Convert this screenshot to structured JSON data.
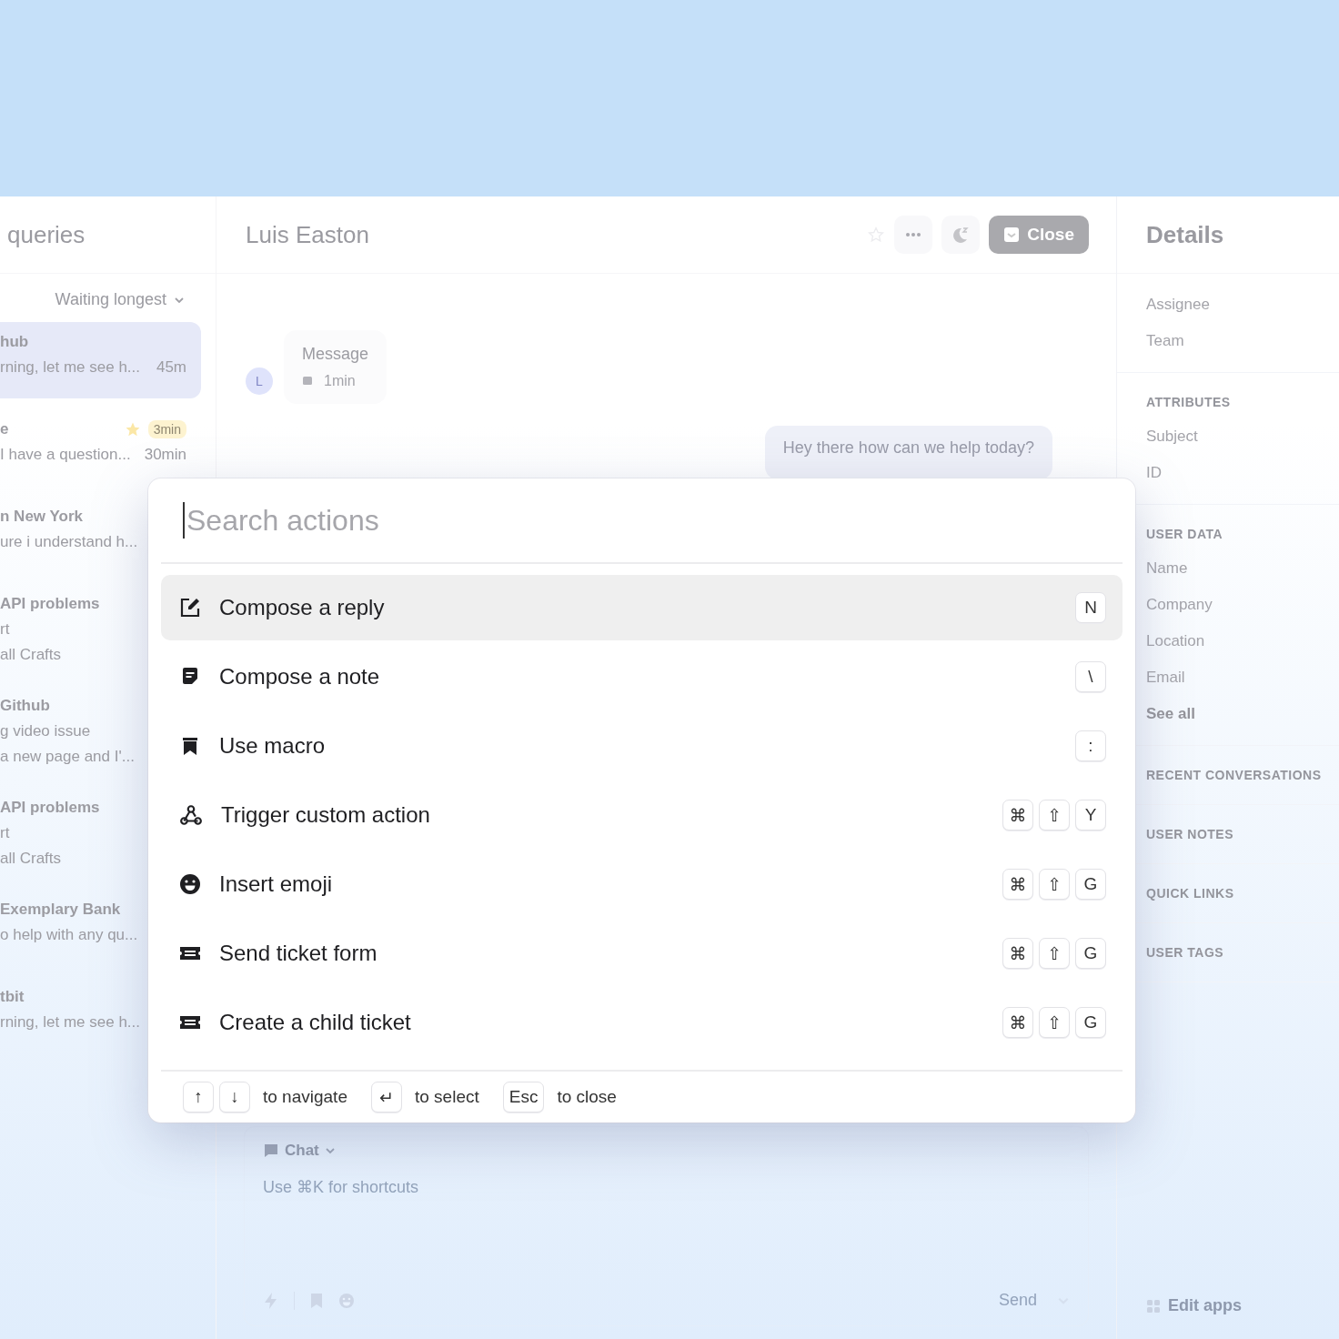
{
  "inbox": {
    "title": "queries",
    "sort": "Waiting longest",
    "conversations": [
      {
        "name": "hub",
        "lines": [
          "rning, let me see h..."
        ],
        "time": "45m",
        "starred": false,
        "selected": true
      },
      {
        "name": "e",
        "lines": [
          "I have a question..."
        ],
        "time": "30min",
        "starred": true,
        "badge": "3min",
        "selected": false
      },
      {
        "name": "n New York",
        "lines": [
          "ure i understand h..."
        ],
        "starred": false,
        "selected": false
      },
      {
        "name": "API problems",
        "lines": [
          "rt",
          "all Crafts"
        ],
        "starred": false,
        "selected": false
      },
      {
        "name": "Github",
        "lines": [
          "g video issue",
          "a new page and I'..."
        ],
        "starred": false,
        "selected": false
      },
      {
        "name": "API problems",
        "lines": [
          "rt",
          "all Crafts"
        ],
        "starred": false,
        "selected": false
      },
      {
        "name": "Exemplary Bank",
        "lines": [
          "o help with any qu..."
        ],
        "starred": false,
        "selected": false
      },
      {
        "name": "tbit",
        "lines": [
          "rning, let me see h..."
        ],
        "starred": false,
        "selected": false
      }
    ]
  },
  "conversation": {
    "title": "Luis Easton",
    "close_label": "Close",
    "incoming": {
      "avatar": "L",
      "text": "Message",
      "time": "1min"
    },
    "outgoing": {
      "text": "Hey there how can we help today?"
    },
    "composer": {
      "channel": "Chat",
      "placeholder": "Use ⌘K for shortcuts",
      "send": "Send"
    }
  },
  "details": {
    "title": "Details",
    "rows": [
      "Assignee",
      "Team"
    ],
    "sections": [
      {
        "title": "ATTRIBUTES",
        "rows": [
          "Subject",
          "ID"
        ]
      },
      {
        "title": "USER DATA",
        "rows": [
          "Name",
          "Company",
          "Location",
          "Email"
        ],
        "link": "See all"
      },
      {
        "title": "RECENT CONVERSATIONS"
      },
      {
        "title": "USER NOTES"
      },
      {
        "title": "QUICK LINKS"
      },
      {
        "title": "USER TAGS"
      }
    ],
    "edit_apps": "Edit apps"
  },
  "command_palette": {
    "placeholder": "Search actions",
    "actions": [
      {
        "label": "Compose a reply",
        "kind": "compose",
        "keys": [
          "N"
        ],
        "selected": true
      },
      {
        "label": "Compose a note",
        "kind": "note",
        "keys": [
          "\\"
        ],
        "selected": false
      },
      {
        "label": "Use macro",
        "kind": "macro",
        "keys": [
          ":"
        ],
        "selected": false
      },
      {
        "label": "Trigger custom action",
        "kind": "webhook",
        "keys": [
          "⌘",
          "⇧",
          "Y"
        ],
        "selected": false
      },
      {
        "label": "Insert emoji",
        "kind": "emoji",
        "keys": [
          "⌘",
          "⇧",
          "G"
        ],
        "selected": false
      },
      {
        "label": "Send ticket form",
        "kind": "ticket",
        "keys": [
          "⌘",
          "⇧",
          "G"
        ],
        "selected": false
      },
      {
        "label": "Create a child ticket",
        "kind": "ticket",
        "keys": [
          "⌘",
          "⇧",
          "G"
        ],
        "selected": false
      }
    ],
    "hints": [
      {
        "keys": [
          "↑",
          "↓"
        ],
        "label": "to navigate"
      },
      {
        "keys": [
          "↵"
        ],
        "label": "to select"
      },
      {
        "keys": [
          "Esc"
        ],
        "label": "to close"
      }
    ]
  }
}
